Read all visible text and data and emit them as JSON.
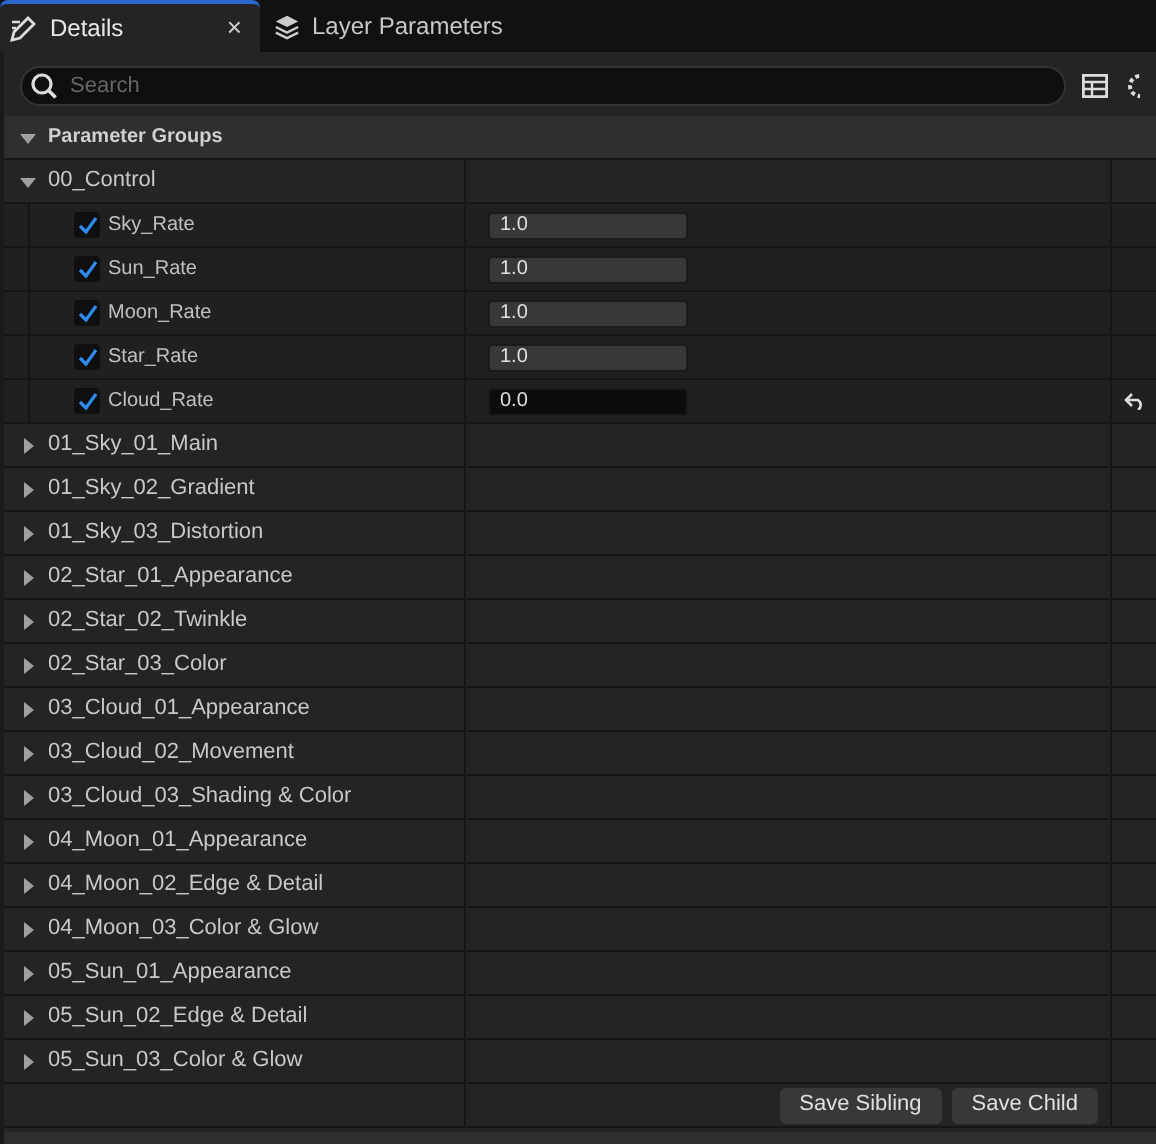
{
  "tabs": [
    {
      "label": "Details",
      "selected": true,
      "kind": "edit",
      "close": "×"
    },
    {
      "label": "Layer Parameters",
      "selected": false,
      "kind": "layers"
    }
  ],
  "search": {
    "placeholder": "Search"
  },
  "section": {
    "title": "Parameter Groups",
    "expanded": true
  },
  "groups": [
    {
      "name": "00_Control",
      "expanded": true,
      "children": [
        {
          "name": "Sky_Rate",
          "checked": true,
          "value": "1.0",
          "modified": false
        },
        {
          "name": "Sun_Rate",
          "checked": true,
          "value": "1.0",
          "modified": false
        },
        {
          "name": "Moon_Rate",
          "checked": true,
          "value": "1.0",
          "modified": false
        },
        {
          "name": "Star_Rate",
          "checked": true,
          "value": "1.0",
          "modified": false
        },
        {
          "name": "Cloud_Rate",
          "checked": true,
          "value": "0.0",
          "modified": true
        }
      ]
    },
    {
      "name": "01_Sky_01_Main",
      "expanded": false
    },
    {
      "name": "01_Sky_02_Gradient",
      "expanded": false
    },
    {
      "name": "01_Sky_03_Distortion",
      "expanded": false
    },
    {
      "name": "02_Star_01_Appearance",
      "expanded": false
    },
    {
      "name": "02_Star_02_Twinkle",
      "expanded": false
    },
    {
      "name": "02_Star_03_Color",
      "expanded": false
    },
    {
      "name": "03_Cloud_01_Appearance",
      "expanded": false
    },
    {
      "name": "03_Cloud_02_Movement",
      "expanded": false
    },
    {
      "name": "03_Cloud_03_Shading & Color",
      "expanded": false
    },
    {
      "name": "04_Moon_01_Appearance",
      "expanded": false
    },
    {
      "name": "04_Moon_02_Edge & Detail",
      "expanded": false
    },
    {
      "name": "04_Moon_03_Color & Glow",
      "expanded": false
    },
    {
      "name": "05_Sun_01_Appearance",
      "expanded": false
    },
    {
      "name": "05_Sun_02_Edge & Detail",
      "expanded": false
    },
    {
      "name": "05_Sun_03_Color & Glow",
      "expanded": false
    }
  ],
  "buttons": [
    "Save Sibling",
    "Save Child"
  ]
}
